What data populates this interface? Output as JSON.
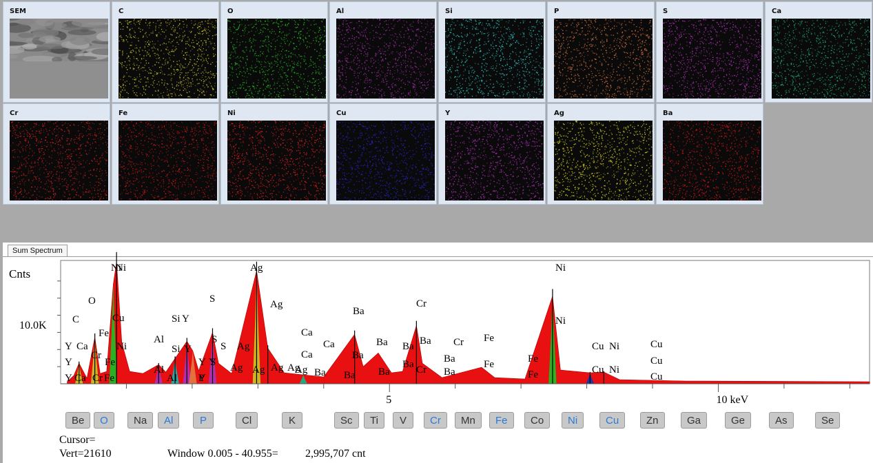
{
  "maps": {
    "row1": [
      {
        "label": "SEM",
        "color": "#808080",
        "kind": "sem"
      },
      {
        "label": "C",
        "color": "#d4cc2a",
        "kind": "dots"
      },
      {
        "label": "O",
        "color": "#22c422",
        "kind": "dots"
      },
      {
        "label": "Al",
        "color": "#b030b8",
        "kind": "dots"
      },
      {
        "label": "Si",
        "color": "#30c8c8",
        "kind": "dots"
      },
      {
        "label": "P",
        "color": "#e07840",
        "kind": "dots"
      },
      {
        "label": "S",
        "color": "#c030c8",
        "kind": "dots"
      },
      {
        "label": "Ca",
        "color": "#20b880",
        "kind": "dots"
      }
    ],
    "row2": [
      {
        "label": "Cr",
        "color": "#e02020",
        "kind": "dots"
      },
      {
        "label": "Fe",
        "color": "#d01818",
        "kind": "dots"
      },
      {
        "label": "Ni",
        "color": "#f02020",
        "kind": "dots"
      },
      {
        "label": "Cu",
        "color": "#2828d8",
        "kind": "dots"
      },
      {
        "label": "Y",
        "color": "#c030c8",
        "kind": "dots"
      },
      {
        "label": "Ag",
        "color": "#e8e020",
        "kind": "dots"
      },
      {
        "label": "Ba",
        "color": "#e01818",
        "kind": "dots"
      }
    ]
  },
  "spectrum": {
    "tab_label": "Sum Spectrum",
    "y_axis_label": "Cnts",
    "y_tick_label": "10.0K",
    "x_tick_labels": [
      "5",
      "10 keV"
    ],
    "peak_labels": [
      "Y",
      "Y",
      "Y",
      "C",
      "Ca",
      "Ca",
      "O",
      "Cr",
      "Cr",
      "Fe",
      "Fe",
      "Fe",
      "Ni",
      "Cu",
      "Ni",
      "Ni",
      "Al",
      "Al",
      "Al",
      "Si",
      "Si",
      "Y",
      "Y",
      "Y",
      "Y",
      "Y",
      "P",
      "S",
      "S",
      "S",
      "S",
      "Ag",
      "Ag",
      "Ag",
      "Ag",
      "Ag",
      "Ag",
      "Ag",
      "Ag",
      "Ca",
      "Ca",
      "Ca",
      "Ba",
      "Ba",
      "Ba",
      "Ba",
      "Ba",
      "Ba",
      "Ba",
      "Ba",
      "Ba",
      "Ba",
      "Ba",
      "Cr",
      "Cr",
      "Cr",
      "Fe",
      "Fe",
      "Fe",
      "Fe",
      "Ni",
      "Ni",
      "Cu",
      "Cu",
      "Ni",
      "Ni",
      "Cu",
      "Cu",
      "Cu"
    ],
    "elements": [
      {
        "symbol": "Be",
        "selected": false
      },
      {
        "symbol": "O",
        "selected": true
      },
      {
        "symbol": "Na",
        "selected": false
      },
      {
        "symbol": "Al",
        "selected": true
      },
      {
        "symbol": "P",
        "selected": true
      },
      {
        "symbol": "Cl",
        "selected": false
      },
      {
        "symbol": "K",
        "selected": false
      },
      {
        "symbol": "Sc",
        "selected": false
      },
      {
        "symbol": "Ti",
        "selected": false
      },
      {
        "symbol": "V",
        "selected": false
      },
      {
        "symbol": "Cr",
        "selected": true
      },
      {
        "symbol": "Mn",
        "selected": false
      },
      {
        "symbol": "Fe",
        "selected": true
      },
      {
        "symbol": "Co",
        "selected": false
      },
      {
        "symbol": "Ni",
        "selected": true
      },
      {
        "symbol": "Cu",
        "selected": true
      },
      {
        "symbol": "Zn",
        "selected": false
      },
      {
        "symbol": "Ga",
        "selected": false
      },
      {
        "symbol": "Ge",
        "selected": false
      },
      {
        "symbol": "As",
        "selected": false
      },
      {
        "symbol": "Se",
        "selected": false
      }
    ],
    "cursor_text": "Cursor=",
    "vert_text": "Vert=21610",
    "window_text": "Window 0.005 - 40.955=",
    "count_text": "2,995,707 cnt"
  },
  "chart_data": {
    "type": "area",
    "title": "",
    "xlabel": "keV",
    "ylabel": "Cnts",
    "xlim": [
      0,
      12.3
    ],
    "ylim": [
      0,
      18000
    ],
    "x_ticks": [
      5,
      10
    ],
    "y_ticks": [
      10000
    ],
    "series": [
      {
        "name": "",
        "values": [
          [
            0.1,
            300
          ],
          [
            0.2,
            1200
          ],
          [
            0.28,
            3000
          ],
          [
            0.4,
            800
          ],
          [
            0.52,
            6800
          ],
          [
            0.6,
            1500
          ],
          [
            0.7,
            1800
          ],
          [
            0.8,
            14500
          ],
          [
            0.85,
            17800
          ],
          [
            0.93,
            6000
          ],
          [
            1.05,
            1800
          ],
          [
            1.25,
            1500
          ],
          [
            1.49,
            2800
          ],
          [
            1.6,
            1700
          ],
          [
            1.74,
            3700
          ],
          [
            1.92,
            6200
          ],
          [
            2.01,
            4800
          ],
          [
            2.1,
            1900
          ],
          [
            2.31,
            7500
          ],
          [
            2.4,
            3000
          ],
          [
            2.6,
            1500
          ],
          [
            2.98,
            16500
          ],
          [
            3.15,
            5200
          ],
          [
            3.4,
            1600
          ],
          [
            3.69,
            1300
          ],
          [
            4.0,
            1000
          ],
          [
            4.47,
            7200
          ],
          [
            4.6,
            2500
          ],
          [
            4.83,
            4500
          ],
          [
            5.03,
            1600
          ],
          [
            5.2,
            1800
          ],
          [
            5.41,
            8500
          ],
          [
            5.5,
            3000
          ],
          [
            5.8,
            900
          ],
          [
            6.4,
            2400
          ],
          [
            6.6,
            900
          ],
          [
            7.06,
            700
          ],
          [
            7.48,
            12800
          ],
          [
            7.6,
            2000
          ],
          [
            8.05,
            1600
          ],
          [
            8.26,
            1700
          ],
          [
            8.5,
            600
          ],
          [
            9.5,
            400
          ],
          [
            12.3,
            300
          ]
        ]
      }
    ]
  }
}
